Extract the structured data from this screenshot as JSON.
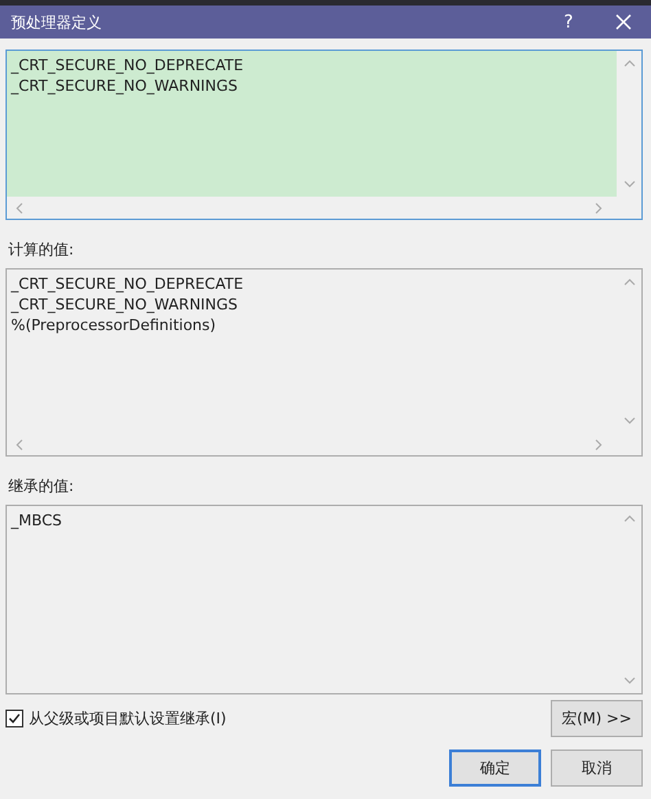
{
  "window": {
    "title": "预处理器定义",
    "help": "?"
  },
  "definitions": {
    "lines": [
      "_CRT_SECURE_NO_DEPRECATE",
      "_CRT_SECURE_NO_WARNINGS"
    ],
    "focused": true
  },
  "evaluated": {
    "label": "计算的值:",
    "lines": [
      "_CRT_SECURE_NO_DEPRECATE",
      "_CRT_SECURE_NO_WARNINGS",
      "%(PreprocessorDefinitions)"
    ]
  },
  "inherited": {
    "label": "继承的值:",
    "lines": [
      "_MBCS"
    ]
  },
  "inherit_checkbox": {
    "label": "从父级或项目默认设置继承(I)",
    "checked": true
  },
  "macros_button": "宏(M) >>",
  "buttons": [
    {
      "label": "确定",
      "default": true
    },
    {
      "label": "取消",
      "default": false
    }
  ]
}
